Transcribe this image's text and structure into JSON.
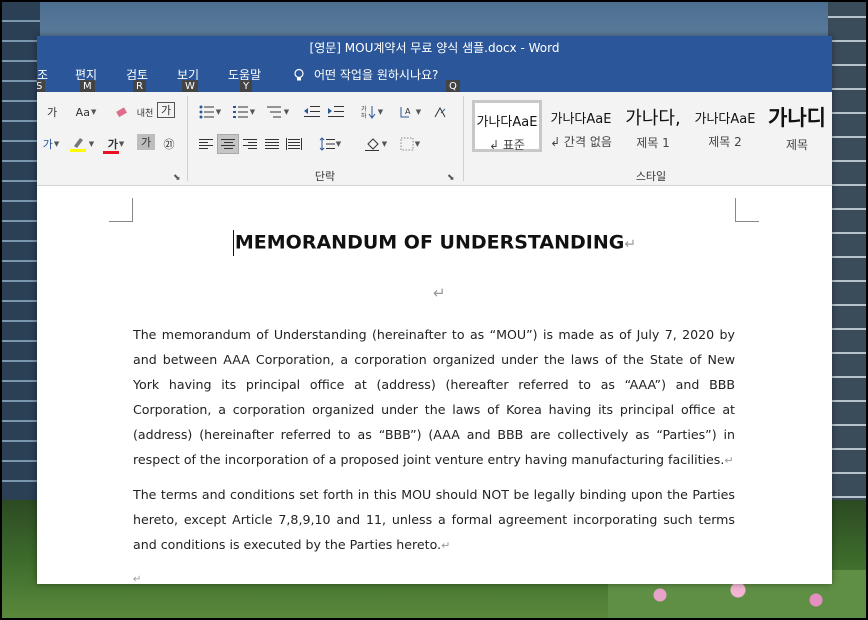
{
  "window": {
    "title": "[영문] MOU계약서 무료 양식 샘플.docx  -  Word"
  },
  "menu": {
    "items": [
      {
        "label": "조",
        "keytip": "S"
      },
      {
        "label": "편지",
        "keytip": "M"
      },
      {
        "label": "검토",
        "keytip": "R"
      },
      {
        "label": "보기",
        "keytip": "W"
      },
      {
        "label": "도움말",
        "keytip": "Y"
      }
    ],
    "tell_me": "어떤 작업을 원하시나요?",
    "tell_me_keytip": "Q"
  },
  "ribbon": {
    "font_group": {
      "buttons": [
        "가",
        "Aa",
        "내천",
        "가",
        "가",
        "가",
        "가",
        "㉑"
      ]
    },
    "paragraph_group": {
      "label": "단락"
    },
    "styles_group": {
      "label": "스타일",
      "styles": [
        {
          "preview": "가나다AaE",
          "name": "↲ 표준",
          "selected": true
        },
        {
          "preview": "가나다AaE",
          "name": "↲ 간격 없음",
          "selected": false
        },
        {
          "preview": "가나다,",
          "name": "제목 1",
          "selected": false
        },
        {
          "preview": "가나다AaE",
          "name": "제목 2",
          "selected": false
        },
        {
          "preview": "가나디",
          "name": "제목",
          "selected": false
        }
      ]
    },
    "colors": {
      "highlight": "#ffff00",
      "font_color": "#e81123",
      "title_bar": "#2b579a"
    }
  },
  "document": {
    "title": "MEMORANDUM OF UNDERSTANDING",
    "paragraph_mark": "↵",
    "paragraphs": [
      "The memorandum of Understanding (hereinafter to as “MOU”) is made as of July 7, 2020 by and between AAA Corporation, a corporation organized under the laws of the State of New York having its principal office at (address) (hereafter referred to as “AAA”) and BBB Corporation, a corporation organized under the laws of Korea having its principal office at (address) (hereinafter referred to as “BBB”) (AAA and BBB are collectively as “Parties”) in respect of the incorporation of a proposed joint venture entry having manufacturing facilities.",
      "The terms and conditions set forth in this MOU should NOT be legally binding upon the Parties hereto, except Article 7,8,9,10 and 11, unless a formal agreement incorporating such terms and conditions is executed by the Parties hereto."
    ]
  }
}
